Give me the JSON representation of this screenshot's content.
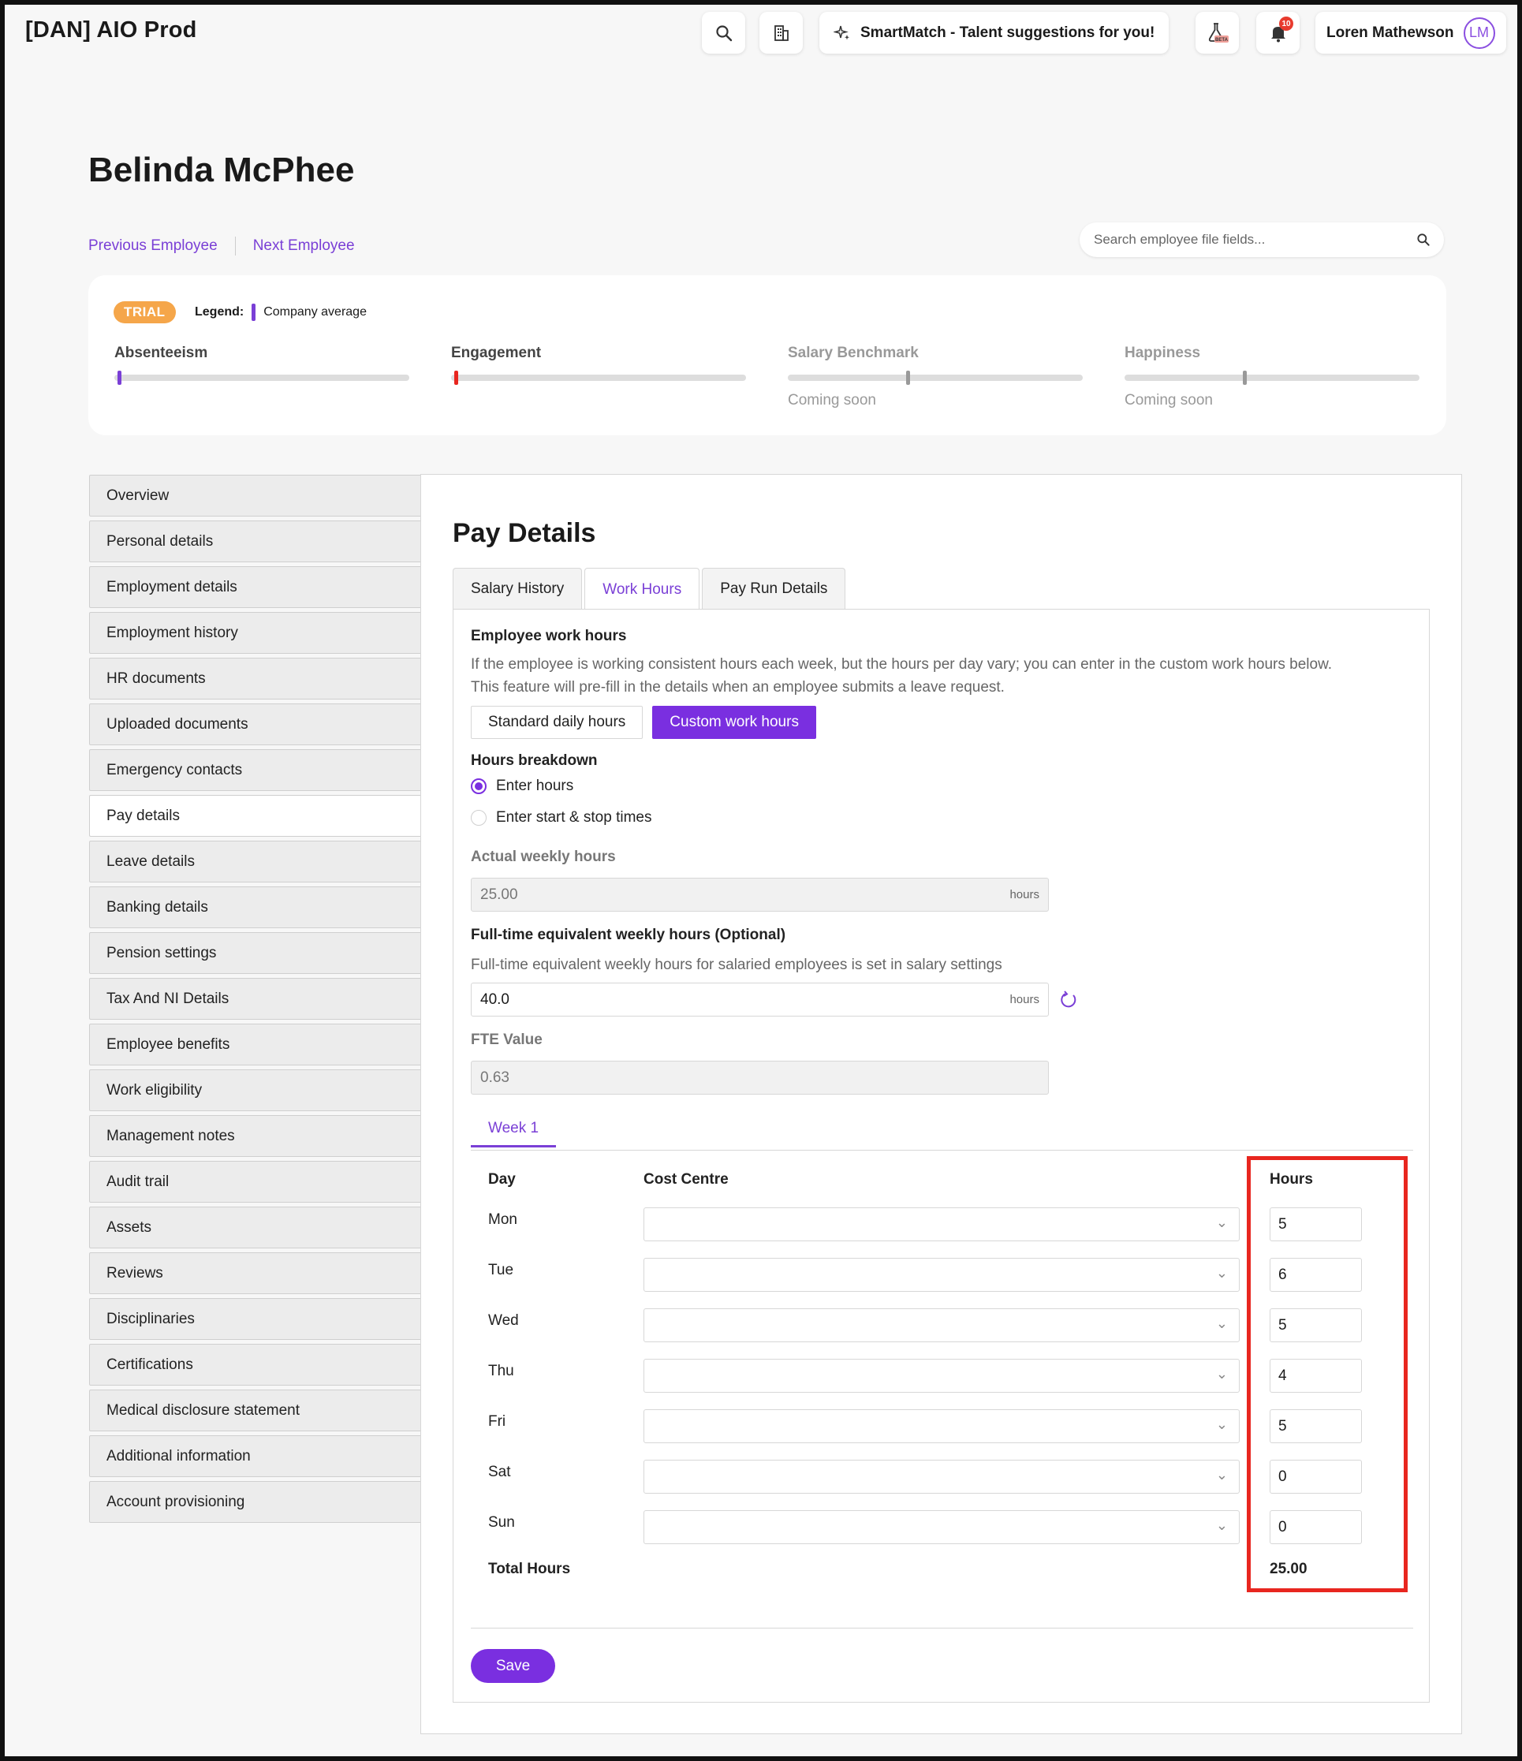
{
  "app": {
    "title": "[DAN] AIO Prod",
    "smartmatch_label": "SmartMatch - Talent suggestions for you!",
    "notification_count": "10",
    "beta_label": "BETA",
    "user_name": "Loren Mathewson",
    "user_initials": "LM"
  },
  "employee": {
    "name": "Belinda McPhee",
    "prev_label": "Previous Employee",
    "next_label": "Next Employee",
    "search_placeholder": "Search employee file fields..."
  },
  "metrics": {
    "trial_label": "TRIAL",
    "legend_label": "Legend:",
    "legend_item": "Company average",
    "items": [
      {
        "label": "Absenteeism",
        "marker_position": 0.01,
        "marker_color": "#7a3fd6"
      },
      {
        "label": "Engagement",
        "marker_position": 0.01,
        "marker_color": "#e8261f"
      },
      {
        "label": "Salary Benchmark",
        "marker_position": 0.4,
        "marker_color": "#999999",
        "note": "Coming soon"
      },
      {
        "label": "Happiness",
        "marker_position": 0.4,
        "marker_color": "#999999",
        "note": "Coming soon"
      }
    ]
  },
  "sidebar": {
    "items": [
      "Overview",
      "Personal details",
      "Employment details",
      "Employment history",
      "HR documents",
      "Uploaded documents",
      "Emergency contacts",
      "Pay details",
      "Leave details",
      "Banking details",
      "Pension settings",
      "Tax And NI Details",
      "Employee benefits",
      "Work eligibility",
      "Management notes",
      "Audit trail",
      "Assets",
      "Reviews",
      "Disciplinaries",
      "Certifications",
      "Medical disclosure statement",
      "Additional information",
      "Account provisioning"
    ],
    "active": "Pay details"
  },
  "pay": {
    "title": "Pay Details",
    "tabs": [
      "Salary History",
      "Work Hours",
      "Pay Run Details"
    ],
    "active_tab": "Work Hours",
    "work_hours_heading": "Employee work hours",
    "work_hours_desc_1": "If the employee is working consistent hours each week, but the hours per day vary; you can enter in the custom work hours below.",
    "work_hours_desc_2": "This feature will pre-fill in the details when an employee submits a leave request.",
    "standard_label": "Standard daily hours",
    "custom_label": "Custom work hours",
    "breakdown_heading": "Hours breakdown",
    "radio_enter_hours": "Enter hours",
    "radio_start_stop": "Enter start & stop times",
    "actual_label": "Actual weekly hours",
    "actual_value": "25.00",
    "unit": "hours",
    "fte_hours_label": "Full-time equivalent weekly hours (Optional)",
    "fte_hours_desc": "Full-time equivalent weekly hours for salaried employees is set in salary settings",
    "fte_hours_value": "40.0",
    "fte_value_label": "FTE Value",
    "fte_value": "0.63",
    "week_tab": "Week 1",
    "col_day": "Day",
    "col_cost_centre": "Cost Centre",
    "col_hours": "Hours",
    "rows": [
      {
        "day": "Mon",
        "hours": "5"
      },
      {
        "day": "Tue",
        "hours": "6"
      },
      {
        "day": "Wed",
        "hours": "5"
      },
      {
        "day": "Thu",
        "hours": "4"
      },
      {
        "day": "Fri",
        "hours": "5"
      },
      {
        "day": "Sat",
        "hours": "0"
      },
      {
        "day": "Sun",
        "hours": "0"
      }
    ],
    "total_label": "Total Hours",
    "total_value": "25.00",
    "save_label": "Save"
  },
  "colors": {
    "accent": "#7a2fe0",
    "highlight": "#e8261f",
    "trial": "#f5a64a"
  }
}
